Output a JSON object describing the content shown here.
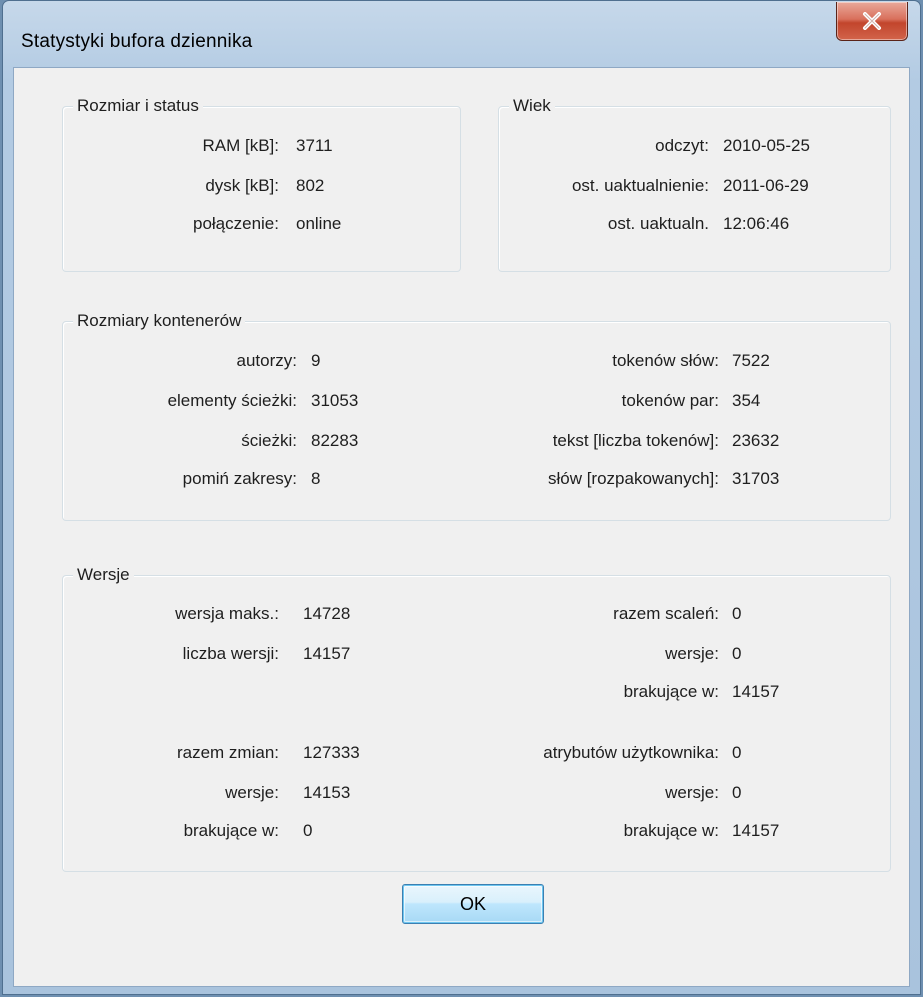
{
  "window": {
    "title": "Statystyki bufora dziennika"
  },
  "size_status": {
    "legend": "Rozmiar i status",
    "rows": [
      {
        "label": "RAM [kB]:",
        "value": "3711"
      },
      {
        "label": "dysk [kB]:",
        "value": "802"
      },
      {
        "label": "połączenie:",
        "value": "online"
      }
    ]
  },
  "age": {
    "legend": "Wiek",
    "rows": [
      {
        "label": "odczyt:",
        "value": "2010-05-25"
      },
      {
        "label": "ost. uaktualnienie:",
        "value": "2011-06-29"
      },
      {
        "label": "ost. uaktualn.",
        "value": "12:06:46"
      }
    ]
  },
  "containers": {
    "legend": "Rozmiary kontenerów",
    "left": [
      {
        "label": "autorzy:",
        "value": "9"
      },
      {
        "label": "elementy ścieżki:",
        "value": "31053"
      },
      {
        "label": "ścieżki:",
        "value": "82283"
      },
      {
        "label": "pomiń zakresy:",
        "value": "8"
      }
    ],
    "right": [
      {
        "label": "tokenów słów:",
        "value": "7522"
      },
      {
        "label": "tokenów par:",
        "value": "354"
      },
      {
        "label": "tekst [liczba tokenów]:",
        "value": "23632"
      },
      {
        "label": "słów [rozpakowanych]:",
        "value": "31703"
      }
    ]
  },
  "versions": {
    "legend": "Wersje",
    "left_top": [
      {
        "label": "wersja maks.:",
        "value": "14728"
      },
      {
        "label": "liczba wersji:",
        "value": "14157"
      }
    ],
    "right_top": [
      {
        "label": "razem scaleń:",
        "value": "0"
      },
      {
        "label": "wersje:",
        "value": "0"
      },
      {
        "label": "brakujące w:",
        "value": "14157"
      }
    ],
    "left_bottom": [
      {
        "label": "razem zmian:",
        "value": "127333"
      },
      {
        "label": "wersje:",
        "value": "14153"
      },
      {
        "label": "brakujące w:",
        "value": "0"
      }
    ],
    "right_bottom": [
      {
        "label": "atrybutów użytkownika:",
        "value": "0"
      },
      {
        "label": "wersje:",
        "value": "0"
      },
      {
        "label": "brakujące w:",
        "value": "14157"
      }
    ]
  },
  "buttons": {
    "ok": "OK"
  },
  "icons": {
    "close": "close-icon"
  },
  "colors": {
    "close_button": "#c2452c",
    "ok_border": "#3c7fb1",
    "dialog_bg": "#f0f0f0"
  }
}
